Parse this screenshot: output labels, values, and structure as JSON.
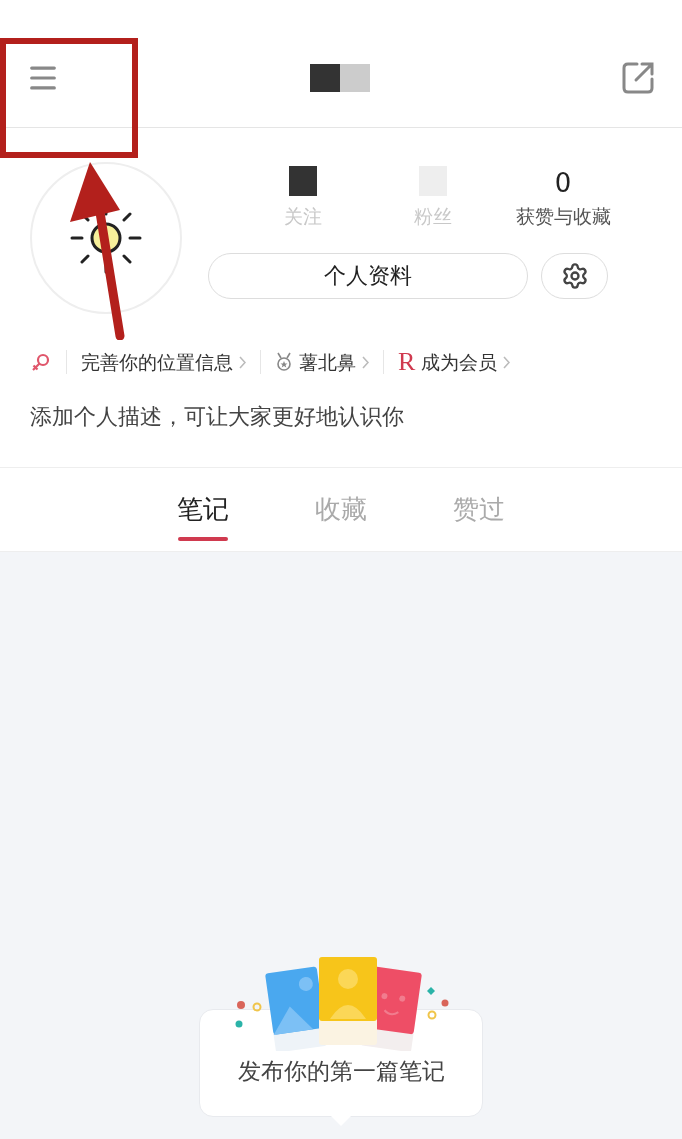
{
  "stats": [
    {
      "label": "关注",
      "obscured": true
    },
    {
      "label": "粉丝",
      "obscured": true
    },
    {
      "label": "获赞与收藏",
      "value": "0",
      "obscured": false
    }
  ],
  "profile_button": "个人资料",
  "tags": [
    {
      "kind": "gender"
    },
    {
      "kind": "location",
      "label": "完善你的位置信息"
    },
    {
      "kind": "medal",
      "label": "薯北鼻"
    },
    {
      "kind": "member",
      "mark": "R",
      "label": "成为会员"
    }
  ],
  "description": "添加个人描述，可让大家更好地认识你",
  "tabs": [
    {
      "label": "笔记",
      "selected": true
    },
    {
      "label": "收藏",
      "selected": false
    },
    {
      "label": "赞过",
      "selected": false
    }
  ],
  "empty_state": {
    "text": "发布你的第一篇笔记"
  }
}
